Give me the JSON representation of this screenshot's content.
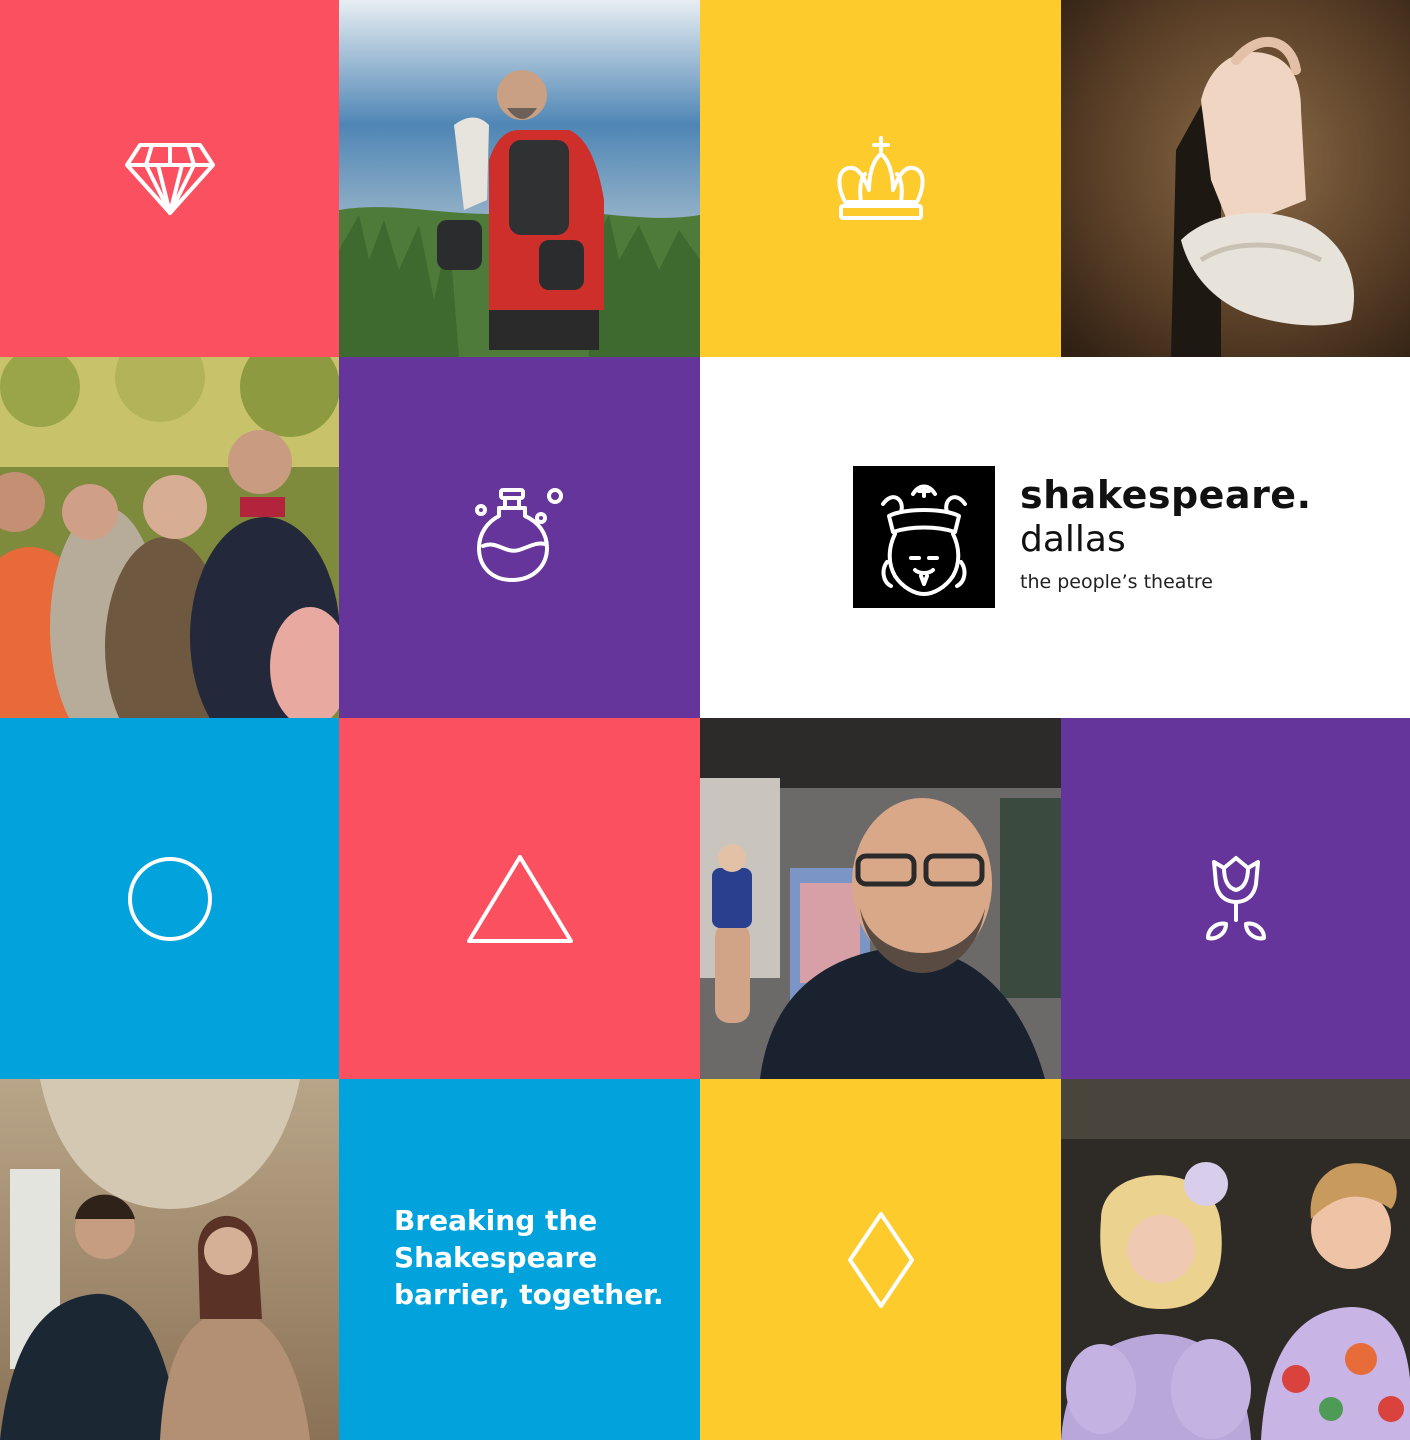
{
  "colors": {
    "coral": "#fa505f",
    "purple": "#65359b",
    "yellow": "#fdcb2c",
    "blue": "#02a2dc",
    "white": "#ffffff",
    "black": "#000000"
  },
  "brand": {
    "name": "shakespeare.",
    "city": "dallas",
    "tagline": "the people’s theatre",
    "logo_icon": "crowned-bard-icon"
  },
  "tagline": {
    "line1": "Breaking the",
    "line2": "Shakespeare",
    "line3": "barrier, together."
  },
  "tiles": [
    {
      "kind": "icon",
      "icon": "diamond-gem-icon",
      "color": "coral"
    },
    {
      "kind": "photo",
      "subject": "actor in armor seated in grass"
    },
    {
      "kind": "icon",
      "icon": "crown-icon",
      "color": "yellow"
    },
    {
      "kind": "photo",
      "subject": "hands with lace cuff"
    },
    {
      "kind": "photo",
      "subject": "period costume ensemble"
    },
    {
      "kind": "icon",
      "icon": "potion-flask-icon",
      "color": "purple"
    },
    {
      "kind": "logo"
    },
    {
      "kind": "icon",
      "icon": "circle-icon",
      "color": "blue"
    },
    {
      "kind": "icon",
      "icon": "triangle-icon",
      "color": "coral"
    },
    {
      "kind": "photo",
      "subject": "man with finger puppet"
    },
    {
      "kind": "icon",
      "icon": "rose-icon",
      "color": "purple"
    },
    {
      "kind": "photo",
      "subject": "couple dancing in palace hall"
    },
    {
      "kind": "text",
      "color": "blue"
    },
    {
      "kind": "icon",
      "icon": "rhombus-icon",
      "color": "yellow"
    },
    {
      "kind": "photo",
      "subject": "two comic actors in wigs"
    }
  ]
}
